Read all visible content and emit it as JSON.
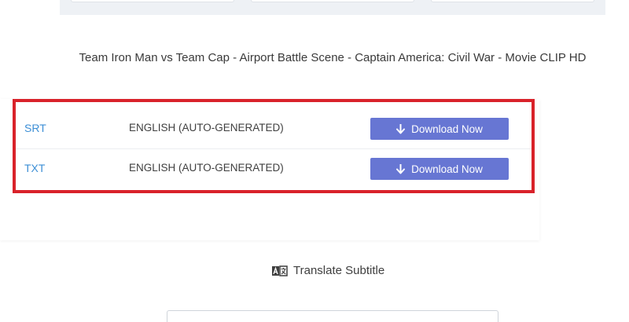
{
  "video": {
    "title": "Team Iron Man vs Team Cap - Airport Battle Scene - Captain America: Civil War - Movie CLIP HD"
  },
  "downloads": [
    {
      "format": "SRT",
      "language": "ENGLISH (AUTO-GENERATED)",
      "button_label": "Download Now"
    },
    {
      "format": "TXT",
      "language": "ENGLISH (AUTO-GENERATED)",
      "button_label": "Download Now"
    }
  ],
  "translate": {
    "label": "Translate Subtitle",
    "icon": "translate-icon"
  },
  "colors": {
    "button": "#6776d3",
    "link": "#3d8fd6",
    "highlight_border": "#d9222a"
  }
}
